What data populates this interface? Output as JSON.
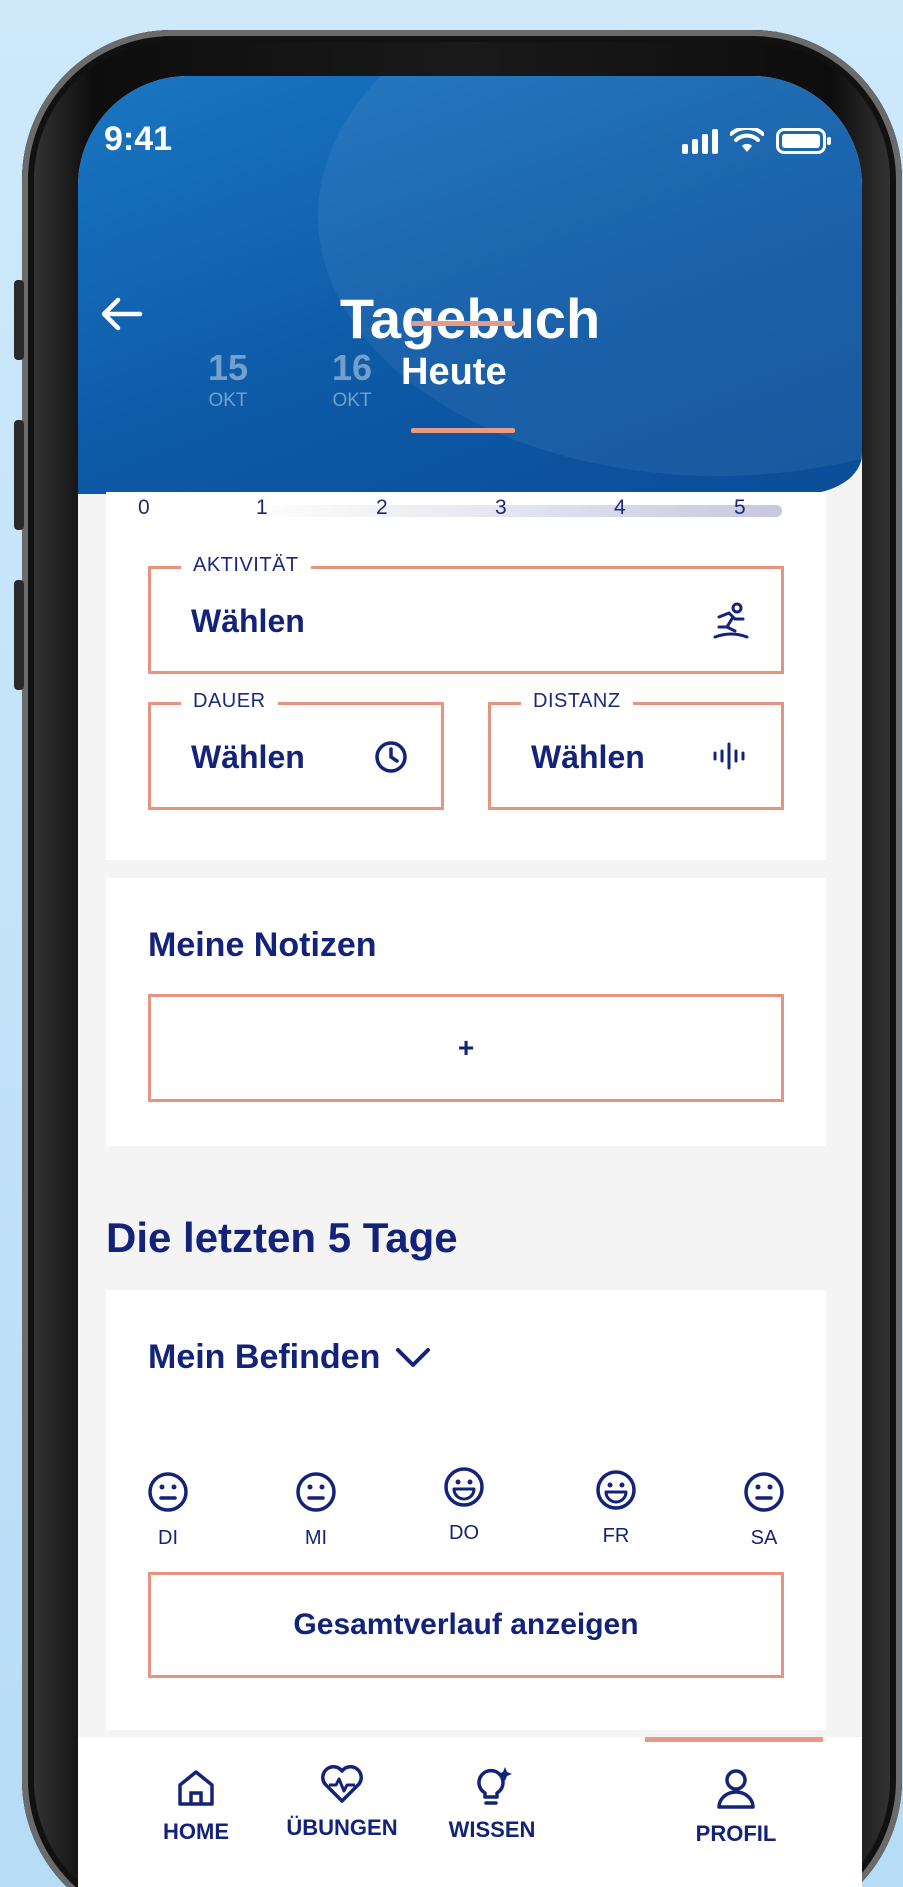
{
  "status_bar": {
    "time": "9:41"
  },
  "header": {
    "title": "Tagebuch",
    "dates": [
      {
        "day": "15",
        "month": "OKT"
      },
      {
        "day": "16",
        "month": "OKT"
      }
    ],
    "today_label": "Heute"
  },
  "scale": {
    "labels": [
      "0",
      "1",
      "2",
      "3",
      "4",
      "5"
    ]
  },
  "activity_form": {
    "activity": {
      "legend": "AKTIVITÄT",
      "value": "Wählen",
      "icon": "running-person-icon"
    },
    "duration": {
      "legend": "DAUER",
      "value": "Wählen",
      "icon": "clock-icon"
    },
    "distance": {
      "legend": "DISTANZ",
      "value": "Wählen",
      "icon": "distance-icon"
    }
  },
  "notes": {
    "title": "Meine Notizen",
    "add_label": "+"
  },
  "last_days": {
    "title": "Die letzten 5 Tage",
    "dropdown_label": "Mein Befinden",
    "days": [
      {
        "label": "DI",
        "mood": "neutral"
      },
      {
        "label": "MI",
        "mood": "neutral"
      },
      {
        "label": "DO",
        "mood": "happy"
      },
      {
        "label": "FR",
        "mood": "happy"
      },
      {
        "label": "SA",
        "mood": "neutral"
      }
    ],
    "history_button": "Gesamtverlauf anzeigen"
  },
  "nav": {
    "items": [
      {
        "label": "HOME",
        "icon": "home-icon"
      },
      {
        "label": "ÜBUNGEN",
        "icon": "heart-pulse-icon"
      },
      {
        "label": "WISSEN",
        "icon": "lightbulb-icon"
      },
      {
        "label": "PROFIL",
        "icon": "person-icon"
      }
    ],
    "active": "PROFIL"
  },
  "colors": {
    "primary": "#14237a",
    "header": "#0d5aa7",
    "accent": "#e8937f"
  }
}
